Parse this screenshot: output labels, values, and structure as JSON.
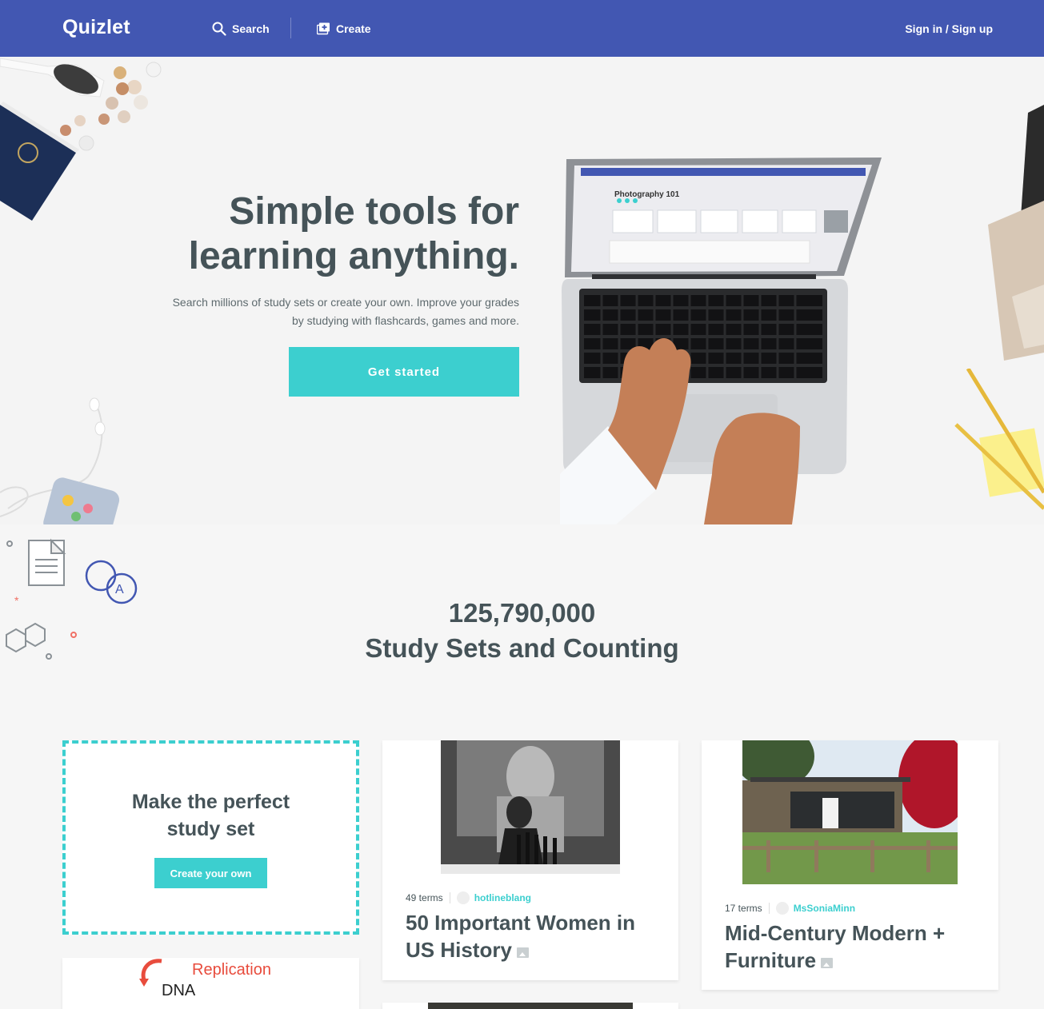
{
  "nav": {
    "logo": "Quizlet",
    "search_label": "Search",
    "create_label": "Create",
    "signin_label": "Sign in / Sign up"
  },
  "hero": {
    "title_line1": "Simple tools for",
    "title_line2": "learning anything.",
    "subtitle_line1": "Search millions of study sets or create your own. Improve your grades",
    "subtitle_line2": "by studying with flashcards, games and more.",
    "cta_label": "Get started",
    "laptop_screen_title": "Photography 101"
  },
  "stats": {
    "count": "125,790,000",
    "label": "Study Sets and Counting"
  },
  "promo": {
    "title_line1": "Make the perfect",
    "title_line2": "study set",
    "button_label": "Create your own"
  },
  "sets": [
    {
      "terms": "49 terms",
      "user": "hotlineblang",
      "title_line1": "50 Important Women in",
      "title_line2": "US History"
    },
    {
      "terms": "17 terms",
      "user": "MsSoniaMinn",
      "title_line1": "Mid-Century Modern +",
      "title_line2": "Furniture"
    },
    {
      "image_text_1": "Replication",
      "image_text_2": "DNA"
    }
  ],
  "colors": {
    "nav_bg": "#4257b2",
    "accent": "#3ccfcf",
    "text": "#455358"
  }
}
